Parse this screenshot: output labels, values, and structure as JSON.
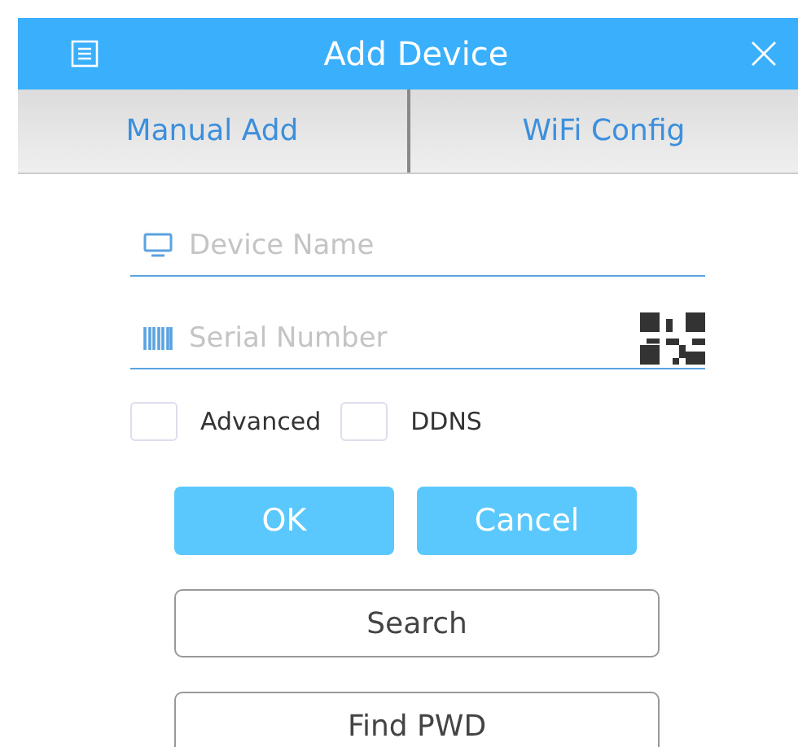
{
  "window": {
    "title": "Add Device"
  },
  "tabs": [
    {
      "label": "Manual Add"
    },
    {
      "label": "WiFi Config"
    }
  ],
  "fields": [
    {
      "kind": "name",
      "placeholder": "Device Name"
    },
    {
      "kind": "serial",
      "placeholder": "Serial Number"
    }
  ],
  "options": [
    {
      "label": "Advanced",
      "checked": false
    },
    {
      "label": "DDNS",
      "checked": false
    }
  ],
  "actions": [
    "OK",
    "Cancel"
  ],
  "buttons": [
    "Search",
    "Find PWD"
  ]
}
